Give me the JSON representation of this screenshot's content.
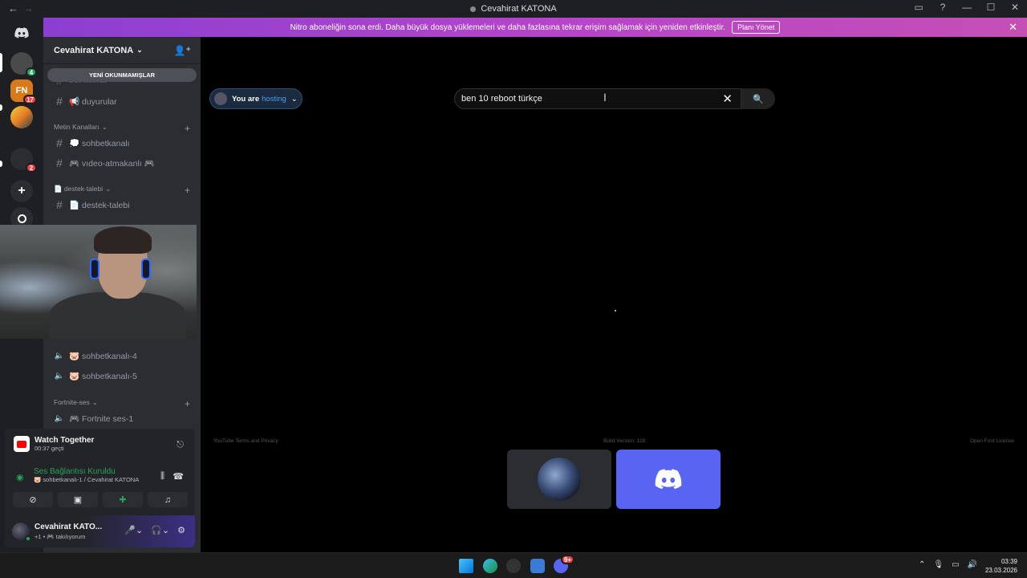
{
  "window": {
    "title": "Cevahirat KATONA",
    "back_icon": "arrow-left-icon",
    "forward_icon": "arrow-right-icon"
  },
  "banner": {
    "text": "Nitro aboneliğin sona erdi. Daha büyük dosya yüklemeleri ve daha fazlasına tekrar erişim sağlamak için yeniden etkinleştir.",
    "manage_label": "Planı Yönet",
    "color": "#b845c9"
  },
  "guilds": [
    {
      "badge": "4"
    },
    {
      "label": "FN",
      "badge": "17"
    },
    {
      "badge": ""
    },
    {
      "badge": "2"
    }
  ],
  "sidebar": {
    "server_name": "Cevahirat KATONA",
    "unread_pill": "YENİ OKUNMAMIŞLAR",
    "partial_top": "bot-komut",
    "channels_top": [
      {
        "name": "📢 duyurular"
      }
    ],
    "category_text": "Metin Kanalları",
    "text_channels": [
      {
        "name": "💭 sohbetkanalı"
      },
      {
        "name": "🎮 vıdeo-atmakanlı 🎮"
      }
    ],
    "category_support": "📄 destek-talebi",
    "support_channels": [
      {
        "name": "📄 destek-talebi"
      }
    ],
    "voice_channels": [
      {
        "name": "🐷 sohbetkanalı-4"
      },
      {
        "name": "🐷 sohbetkanalı-5"
      }
    ],
    "category_fortnite": "Fortnite-ses",
    "fortnite_channels": [
      {
        "name": "🎮 Fortnite ses-1"
      }
    ]
  },
  "activity": {
    "title": "Watch Together",
    "elapsed": "00:37 geçti"
  },
  "voice": {
    "status": "Ses Bağlantısı Kuruldu",
    "channel": "🐷 sohbetkanalı-1 / Cevahirat KATONA"
  },
  "user": {
    "name": "Cevahirat KATO...",
    "status": "+1 • 🎮 takılıyorum"
  },
  "watch": {
    "host_prefix": "You are",
    "host_word": "hosting",
    "search_value": "ben 10 reboot türkçe",
    "footer_left": "YouTube Terms and Privacy",
    "footer_mid": "Build Version: 128",
    "footer_right": "Open Font License"
  },
  "clock": {
    "time": "03:39",
    "date": "23.03.2026"
  },
  "taskbar_badge": "9+"
}
